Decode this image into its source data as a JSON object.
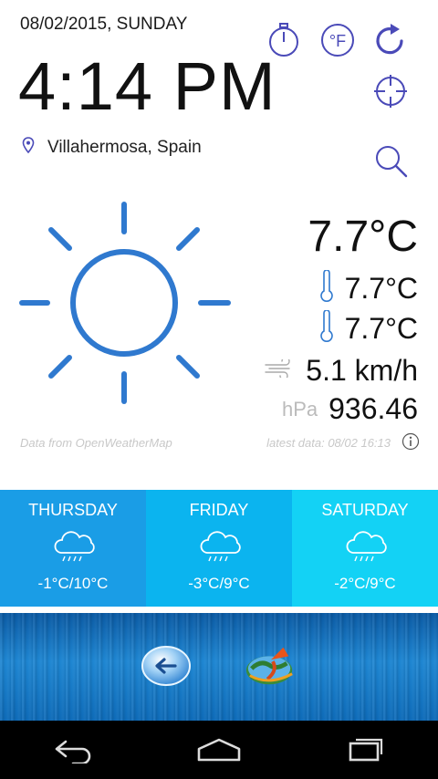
{
  "header": {
    "date": "08/02/2015, SUNDAY",
    "time": "4:14 PM",
    "location": "Villahermosa, Spain"
  },
  "icons": {
    "stopwatch": "stopwatch-icon",
    "fahrenheit": "°F",
    "refresh": "refresh-icon",
    "locate": "crosshair-icon",
    "search": "search-icon",
    "location_pin": "location-pin-icon"
  },
  "current": {
    "temperature": "7.7°C",
    "temp_max": "7.7°C",
    "temp_min": "7.7°C",
    "wind": "5.1 km/h",
    "pressure_unit": "hPa",
    "pressure": "936.46"
  },
  "footer_info": {
    "source": "Data from OpenWeatherMap",
    "latest": "latest data: 08/02 16:13"
  },
  "forecast": [
    {
      "day": "THURSDAY",
      "temps": "-1°C/10°C",
      "color": "#1a9de6"
    },
    {
      "day": "FRIDAY",
      "temps": "-3°C/9°C",
      "color": "#0bb4ef"
    },
    {
      "day": "SATURDAY",
      "temps": "-2°C/9°C",
      "color": "#13d2f5"
    }
  ],
  "colors": {
    "accent_blue": "#2f79cf",
    "icon_purple": "#4a4ab8"
  },
  "apps": [
    "back-arrow-app-icon",
    "globe-app-icon"
  ],
  "navbar": [
    "back-icon",
    "home-icon",
    "recents-icon"
  ]
}
